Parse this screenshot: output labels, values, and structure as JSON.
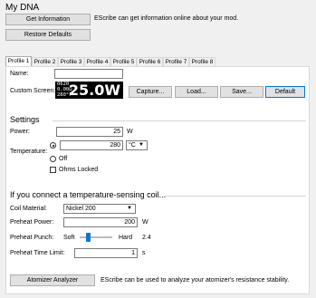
{
  "app": {
    "title": "My DNA"
  },
  "top": {
    "get_info_label": "Get Information",
    "get_info_desc": "EScribe can get information online about your mod.",
    "restore_label": "Restore Defaults"
  },
  "tabs": [
    "Profile 1",
    "Profile 2",
    "Profile 3",
    "Profile 4",
    "Profile 5",
    "Profile 6",
    "Profile 7",
    "Profile 8"
  ],
  "profile": {
    "name_label": "Name:",
    "name_value": "",
    "custom_screen_label": "Custom Screen:",
    "lcd_lines": [
      "0620",
      "0.00Ω",
      "280°F"
    ],
    "lcd_big": "25.0W",
    "capture_label": "Capture...",
    "load_label": "Load...",
    "save_label": "Save...",
    "default_label": "Default"
  },
  "settings": {
    "heading": "Settings",
    "power_label": "Power:",
    "power_value": "25",
    "power_unit": "W",
    "temperature_label": "Temperature:",
    "temperature_value": "280",
    "temperature_unit": "°C",
    "off_label": "Off",
    "ohms_locked_label": "Ohms Locked"
  },
  "coil": {
    "heading": "If you connect a temperature-sensing coil...",
    "material_label": "Coil Material:",
    "material_value": "Nickel 200",
    "preheat_power_label": "Preheat Power:",
    "preheat_power_value": "200",
    "preheat_power_unit": "W",
    "preheat_punch_label": "Preheat Punch:",
    "soft_label": "Soft",
    "hard_label": "Hard",
    "punch_value": "2.4",
    "preheat_time_label": "Preheat Time Limit:",
    "preheat_time_value": "1",
    "preheat_time_unit": "s"
  },
  "atomizer": {
    "button_label": "Atomizer Analyzer",
    "desc": "EScribe can be used to analyze your atomizer's resistance stability."
  }
}
